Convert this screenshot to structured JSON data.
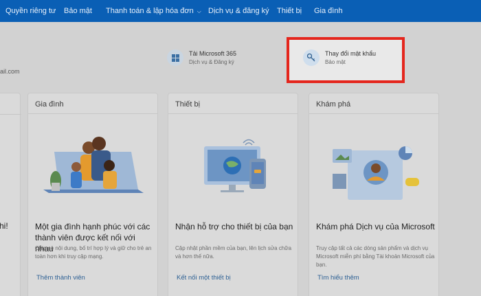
{
  "nav": {
    "items": [
      {
        "label": "Quyền riêng tư"
      },
      {
        "label": "Bảo mật"
      },
      {
        "label": "Thanh toán & lập hóa đơn",
        "chevron": "chevron-down-icon"
      },
      {
        "label": "Dịch vụ & đăng ký"
      },
      {
        "label": "Thiết bị"
      },
      {
        "label": "Gia đình"
      }
    ]
  },
  "profile": {
    "email_fragment": "ail.com"
  },
  "quick_actions": [
    {
      "title": "Tải Microsoft 365",
      "subtitle": "Dịch vụ & Đăng ký",
      "icon": "windows-logo-icon"
    },
    {
      "title": "Thay đổi mật khẩu",
      "subtitle": "Bảo mật",
      "icon": "key-icon"
    }
  ],
  "left_card": {
    "fragment": "hi!"
  },
  "cards": [
    {
      "header": "Gia đình",
      "title": "Một gia đình hạnh phúc với các thành viên được kết nối với nhau",
      "description": "Chia sẻ nội dung, bố trí hợp lý và giữ cho trẻ an toàn hơn khi truy cập mạng.",
      "link": "Thêm thành viên"
    },
    {
      "header": "Thiết bị",
      "title": "Nhận hỗ trợ cho thiết bị của bạn",
      "description": "Cập nhật phần mềm của bạn, lên lịch sửa chữa và hơn thế nữa.",
      "link": "Kết nối một thiết bị"
    },
    {
      "header": "Khám phá",
      "title": "Khám phá Dịch vụ của Microsoft",
      "description": "Truy cập tất cả các dòng sản phẩm và dịch vụ Microsoft miễn phí bằng Tài khoản Microsoft của bạn.",
      "link": "Tìm hiểu thêm"
    }
  ],
  "colors": {
    "nav_bg": "#0a5fb5",
    "highlight": "#e4261d",
    "link": "#2c5f93"
  }
}
